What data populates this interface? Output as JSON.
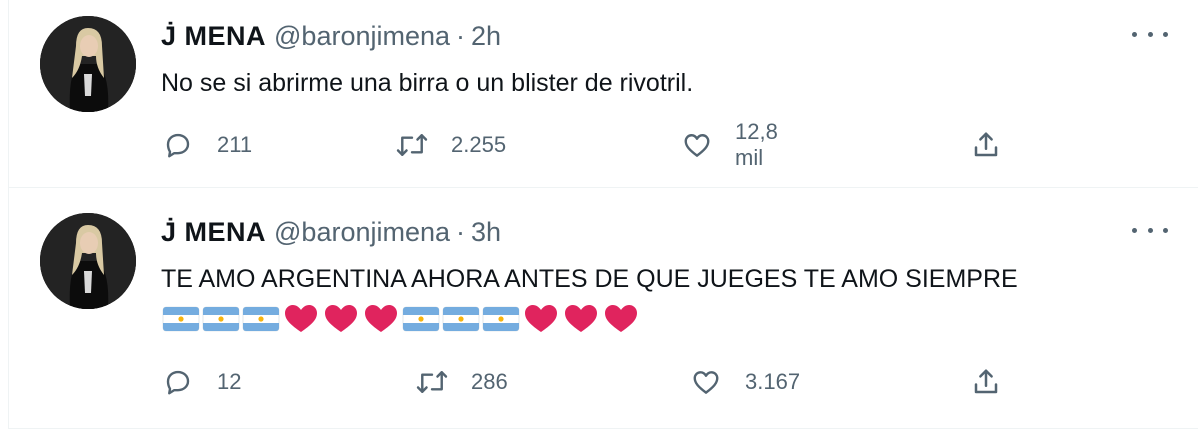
{
  "tweets": [
    {
      "display_name": "J̇ MENA",
      "handle": "@baronjimena",
      "separator": "·",
      "time": "2h",
      "text": "No se si abrirme una birra o un blister de rivotril.",
      "emojis": [],
      "replies": "211",
      "retweets": "2.255",
      "likes": "12,8 mil"
    },
    {
      "display_name": "J̇ MENA",
      "handle": "@baronjimena",
      "separator": "·",
      "time": "3h",
      "text": "TE AMO ARGENTINA AHORA ANTES DE QUE JUEGES TE AMO SIEMPRE",
      "emojis": [
        "argentina-flag",
        "argentina-flag",
        "argentina-flag",
        "red-heart",
        "red-heart",
        "red-heart",
        "argentina-flag",
        "argentina-flag",
        "argentina-flag",
        "red-heart",
        "red-heart",
        "red-heart"
      ],
      "replies": "12",
      "retweets": "286",
      "likes": "3.167"
    }
  ],
  "colors": {
    "text": "#0f1419",
    "secondary": "#536471",
    "divider": "#eff3f4",
    "flag_blue": "#74acdf",
    "heart_red": "#e0245e"
  },
  "icons": [
    "reply-icon",
    "retweet-icon",
    "like-icon",
    "share-icon",
    "more-icon"
  ]
}
